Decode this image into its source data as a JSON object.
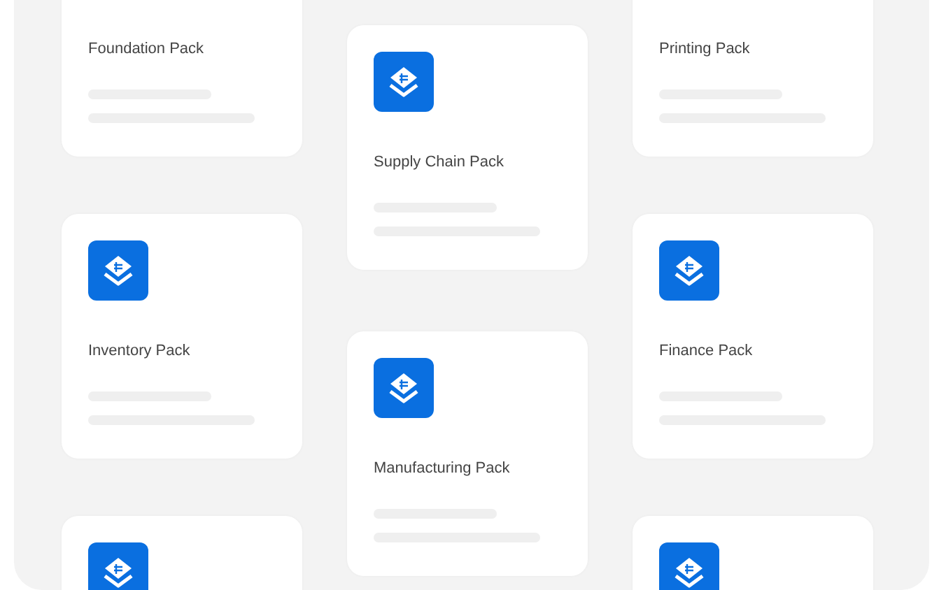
{
  "columns": [
    {
      "cards": [
        {
          "title": "Foundation Pack"
        },
        {
          "title": "Inventory Pack",
          "icon": true
        },
        {
          "icon": true
        }
      ]
    },
    {
      "cards": [
        {
          "title": "Supply Chain Pack",
          "icon": true
        },
        {
          "title": "Manufacturing Pack",
          "icon": true
        }
      ]
    },
    {
      "cards": [
        {
          "title": "Printing Pack"
        },
        {
          "title": "Finance Pack",
          "icon": true
        },
        {
          "icon": true
        }
      ]
    }
  ]
}
